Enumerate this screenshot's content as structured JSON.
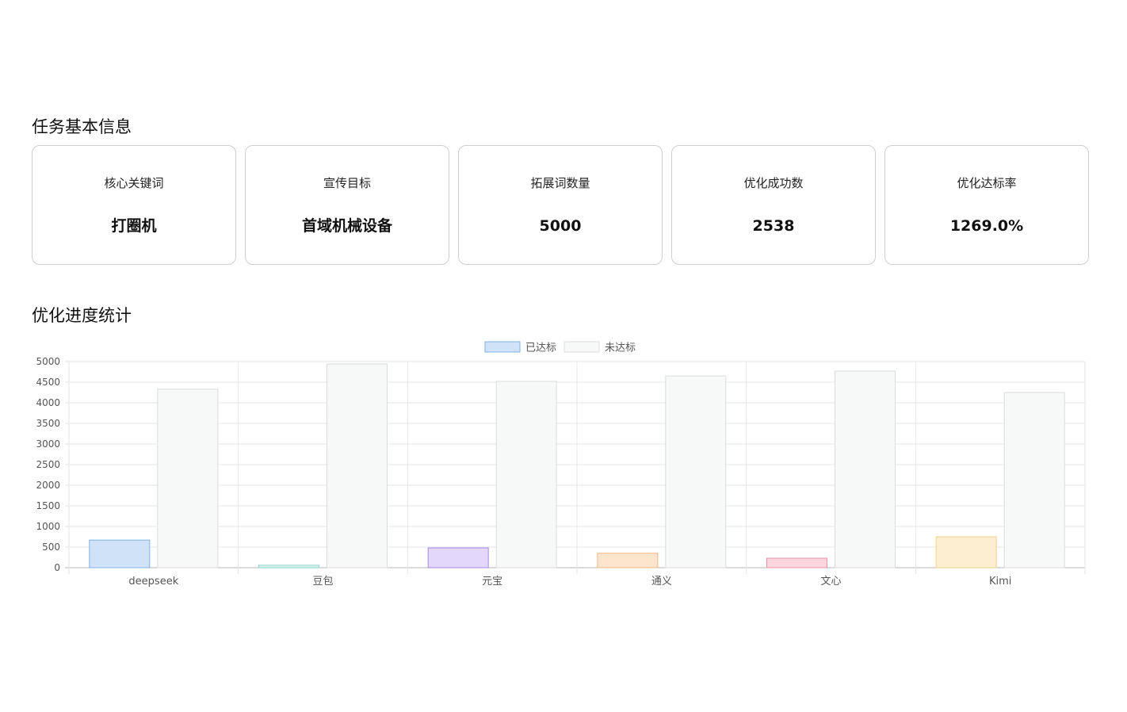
{
  "sections": {
    "basic_title": "任务基本信息",
    "progress_title": "优化进度统计"
  },
  "cards": [
    {
      "label": "核心关键词",
      "value": "打圈机"
    },
    {
      "label": "宣传目标",
      "value": "首域机械设备"
    },
    {
      "label": "拓展词数量",
      "value": "5000"
    },
    {
      "label": "优化成功数",
      "value": "2538"
    },
    {
      "label": "优化达标率",
      "value": "1269.0%"
    }
  ],
  "chart_data": {
    "type": "bar",
    "title": "",
    "xlabel": "",
    "ylabel": "",
    "ylim": [
      0,
      5000
    ],
    "yticks": [
      0,
      500,
      1000,
      1500,
      2000,
      2500,
      3000,
      3500,
      4000,
      4500,
      5000
    ],
    "grid": true,
    "legend_position": "top-center",
    "categories": [
      "deepseek",
      "豆包",
      "元宝",
      "通义",
      "文心",
      "Kimi"
    ],
    "series": [
      {
        "name": "已达标",
        "values": [
          670,
          60,
          480,
          350,
          230,
          750
        ],
        "fill_colors": [
          "#cfe2f7",
          "#d8f1ee",
          "#e4d7fc",
          "#fde4cd",
          "#fbd7dd",
          "#fdeecf"
        ],
        "stroke_colors": [
          "#7fb2e5",
          "#8fd3ca",
          "#a58be8",
          "#f1b886",
          "#ec93a4",
          "#f2d28e"
        ],
        "legend_fill": "#cfe2f7",
        "legend_stroke": "#7fb2e5"
      },
      {
        "name": "未达标",
        "values": [
          4330,
          4940,
          4520,
          4650,
          4770,
          4250
        ],
        "fill_color": "#f7f8f8",
        "stroke_color": "#dcdcdc",
        "legend_fill": "#f7f8f8",
        "legend_stroke": "#dcdcdc"
      }
    ]
  }
}
